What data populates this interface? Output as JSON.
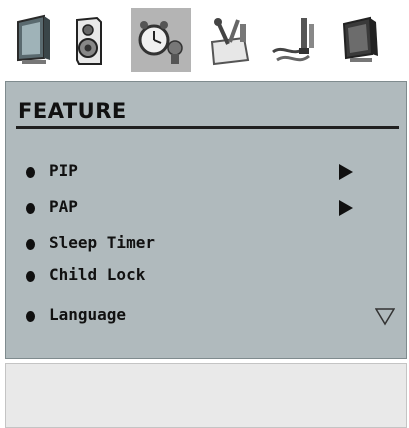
{
  "icon_bar": {
    "icons": [
      "picture-icon",
      "sound-icon",
      "feature-icon",
      "install-icon",
      "source-icon",
      "setup-icon"
    ],
    "active": "feature-icon"
  },
  "menu": {
    "title": "FEATURE",
    "items": [
      {
        "label": "PIP",
        "has_submenu": true
      },
      {
        "label": "PAP",
        "has_submenu": true
      },
      {
        "label": "Sleep Timer",
        "has_submenu": false
      },
      {
        "label": "Child Lock",
        "has_submenu": false
      },
      {
        "label": "Language",
        "has_submenu": false
      }
    ],
    "more_indicator": "down-arrow-icon"
  },
  "colors": {
    "panel_bg": "#b0babd",
    "active_icon_bg": "#b4b4b4",
    "text": "#111111"
  }
}
